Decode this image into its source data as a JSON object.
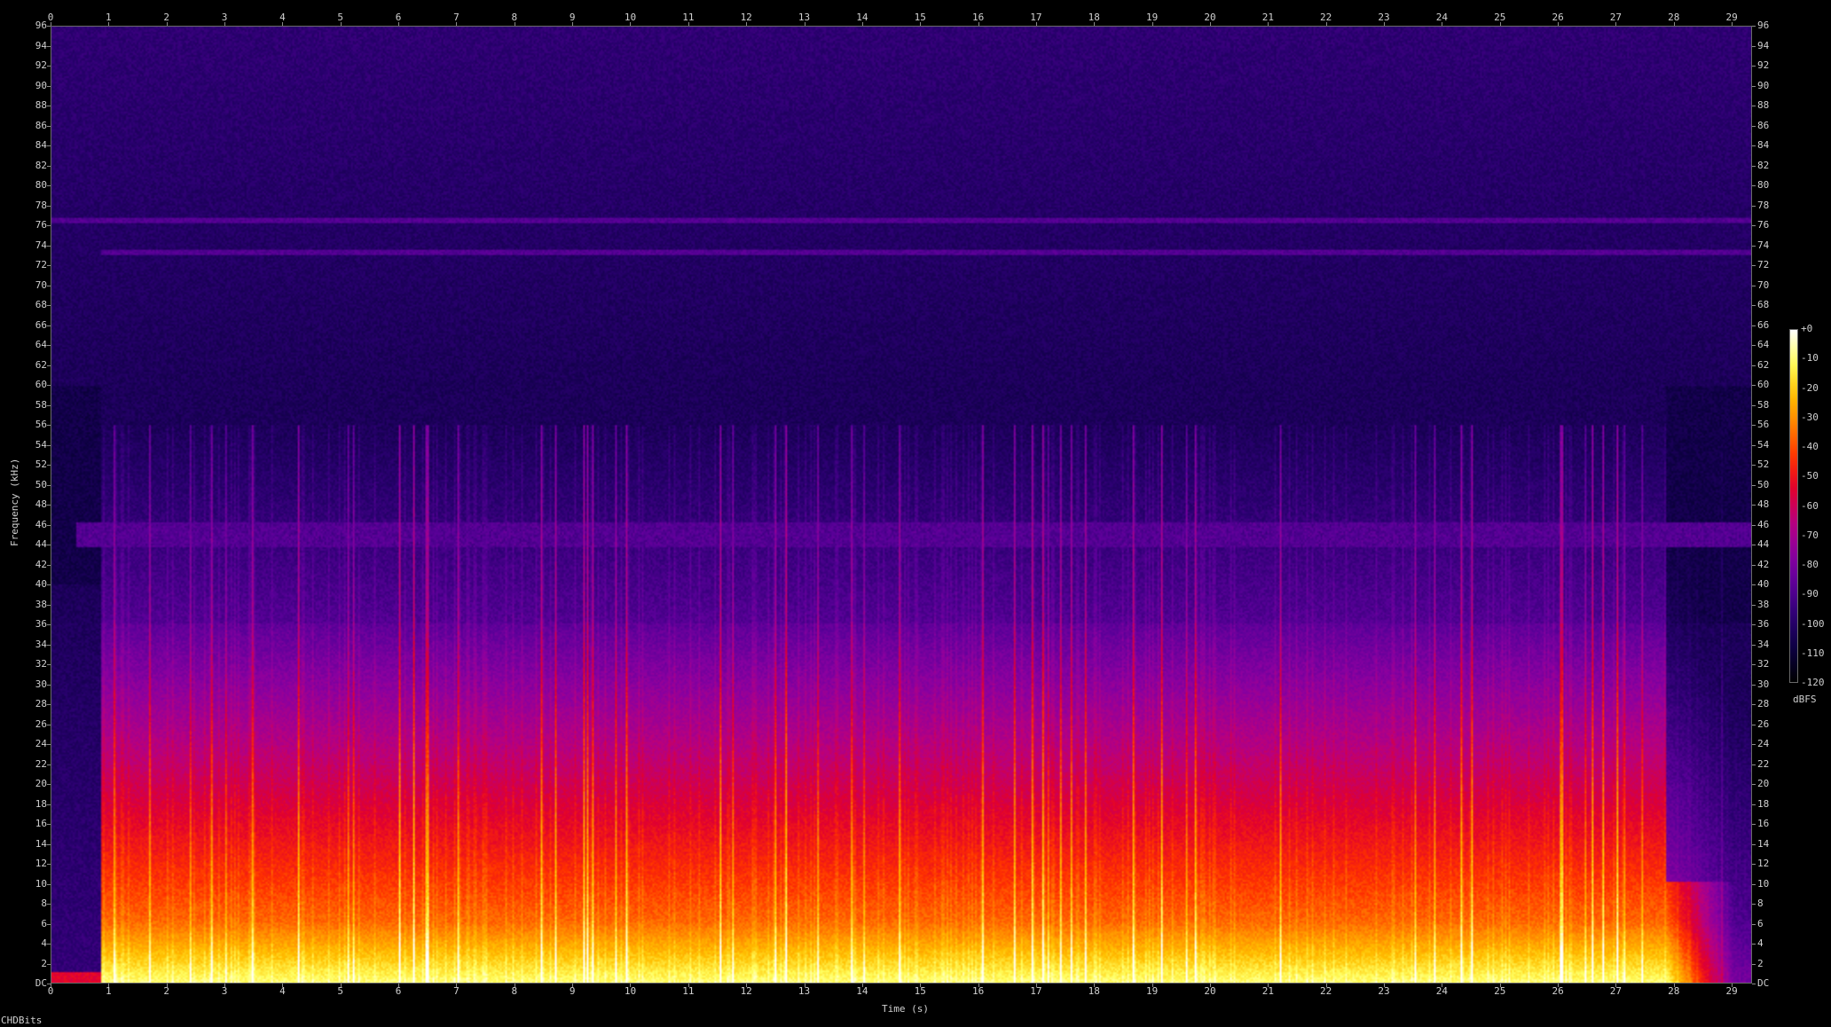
{
  "chart_data": {
    "type": "heatmap",
    "title": "",
    "xlabel": "Time (s)",
    "ylabel": "Frequency (kHz)",
    "xlim": [
      0,
      29.35
    ],
    "ylim": [
      0,
      96
    ],
    "x_ticks": [
      "0",
      "1",
      "2",
      "3",
      "4",
      "5",
      "6",
      "7",
      "8",
      "9",
      "10",
      "11",
      "12",
      "13",
      "14",
      "15",
      "16",
      "17",
      "18",
      "19",
      "20",
      "21",
      "22",
      "23",
      "24",
      "25",
      "26",
      "27",
      "28",
      "29"
    ],
    "y_ticks": [
      "DC",
      "2",
      "4",
      "6",
      "8",
      "10",
      "12",
      "14",
      "16",
      "18",
      "20",
      "22",
      "24",
      "26",
      "28",
      "30",
      "32",
      "34",
      "36",
      "38",
      "40",
      "42",
      "44",
      "46",
      "48",
      "50",
      "52",
      "54",
      "56",
      "58",
      "60",
      "62",
      "64",
      "66",
      "68",
      "70",
      "72",
      "74",
      "76",
      "78",
      "80",
      "82",
      "84",
      "86",
      "88",
      "90",
      "92",
      "94",
      "96"
    ],
    "colorbar": {
      "label": "dBFS",
      "ticks": [
        "+0",
        "-10",
        "-20",
        "-30",
        "-40",
        "-50",
        "-60",
        "-70",
        "-80",
        "-90",
        "-100",
        "-110",
        "-120"
      ],
      "range": [
        -120,
        0
      ],
      "palette": [
        "#000000",
        "#0c0040",
        "#2a0070",
        "#5a0099",
        "#8a00a0",
        "#b80080",
        "#e00030",
        "#ff3000",
        "#ff8000",
        "#ffc000",
        "#ffff60",
        "#ffffff"
      ]
    },
    "features": {
      "signal_start_s": 0.85,
      "signal_end_s": 27.9,
      "main_energy_cutoff_khz": 36,
      "lowpass_shelf_khz": 6,
      "noise_band_khz": 45,
      "tone_lines_khz": [
        76.6,
        73.4
      ]
    }
  },
  "watermark": "CHDBits"
}
